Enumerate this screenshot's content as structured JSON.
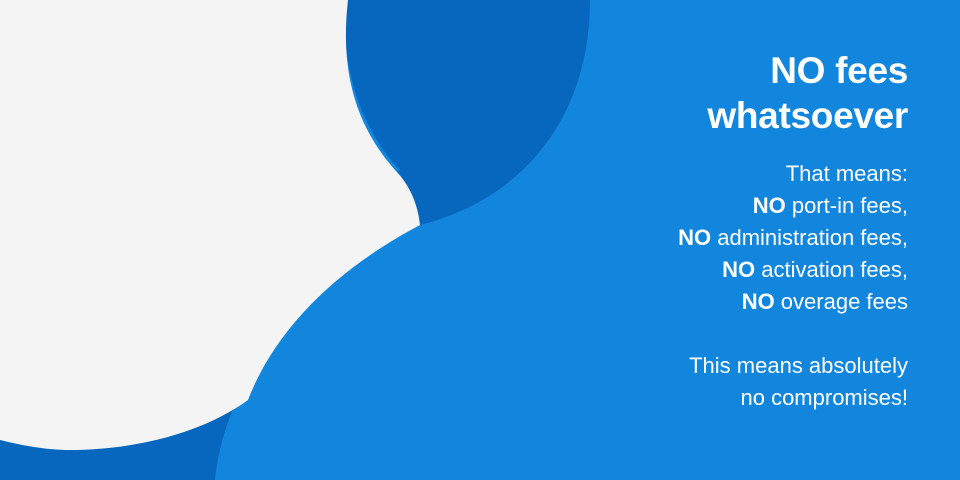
{
  "colors": {
    "background_blue": "#1285dc",
    "dark_blue": "#0766bd",
    "light_gray": "#f4f4f4",
    "text": "#ffffff"
  },
  "headline": {
    "line1": "NO fees",
    "line2": "whatsoever"
  },
  "intro": "That means:",
  "fees": [
    {
      "prefix": "NO",
      "text": " port-in fees,"
    },
    {
      "prefix": "NO",
      "text": " administration fees,"
    },
    {
      "prefix": "NO",
      "text": " activation fees,"
    },
    {
      "prefix": "NO",
      "text": " overage fees"
    }
  ],
  "closing": {
    "line1": "This means absolutely",
    "line2": "no compromises!"
  }
}
